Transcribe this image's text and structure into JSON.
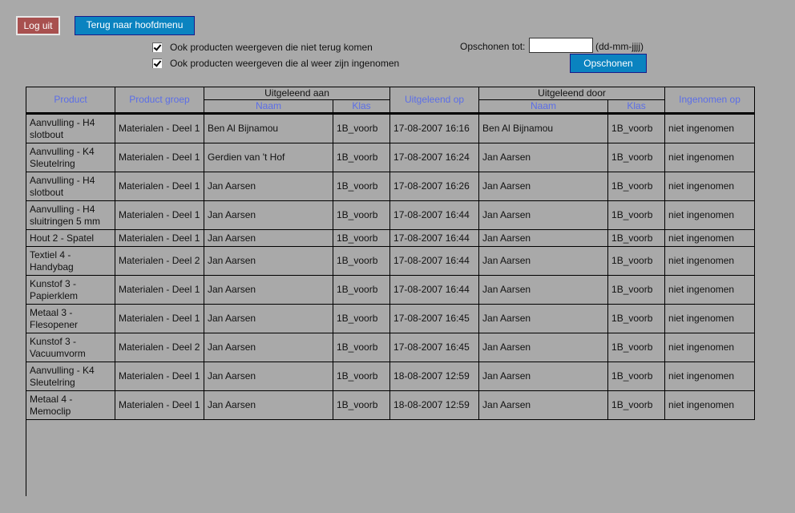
{
  "toolbar": {
    "logout_label": "Log uit",
    "back_label": "Terug naar hoofdmenu"
  },
  "filters": [
    {
      "label": "Ook producten weergeven die niet terug komen",
      "checked": true
    },
    {
      "label": "Ook producten weergeven die al weer zijn ingenomen",
      "checked": true
    }
  ],
  "cleanup": {
    "label": "Opschonen tot:",
    "value": "",
    "placeholder": "",
    "hint": "(dd-mm-jjjj)",
    "button_label": "Opschonen"
  },
  "colors": {
    "background": "#a9a9a9",
    "logout": "#a8504f",
    "primary_button": "#0a83c0",
    "header_link": "#5b6ee8"
  },
  "table": {
    "headers": {
      "product": "Product",
      "product_group": "Product groep",
      "lent_to": "Uitgeleend aan",
      "lent_on": "Uitgeleend op",
      "lent_by": "Uitgeleend door",
      "returned_on": "Ingenomen op",
      "name": "Naam",
      "class": "Klas"
    },
    "rows": [
      {
        "product": "Aanvulling - H4 slotbout",
        "group": "Materialen - Deel 1",
        "to_name": "Ben Al Bijnamou",
        "to_class": "1B_voorb",
        "date": "17-08-2007 16:16",
        "by_name": "Ben Al Bijnamou",
        "by_class": "1B_voorb",
        "returned": "niet ingenomen"
      },
      {
        "product": "Aanvulling - K4 Sleutelring",
        "group": "Materialen - Deel 1",
        "to_name": "Gerdien van 't Hof",
        "to_class": "1B_voorb",
        "date": "17-08-2007 16:24",
        "by_name": "Jan Aarsen",
        "by_class": "1B_voorb",
        "returned": "niet ingenomen"
      },
      {
        "product": "Aanvulling - H4 slotbout",
        "group": "Materialen - Deel 1",
        "to_name": "Jan Aarsen",
        "to_class": "1B_voorb",
        "date": "17-08-2007 16:26",
        "by_name": "Jan Aarsen",
        "by_class": "1B_voorb",
        "returned": "niet ingenomen"
      },
      {
        "product": "Aanvulling - H4 sluitringen 5 mm",
        "group": "Materialen - Deel 1",
        "to_name": "Jan Aarsen",
        "to_class": "1B_voorb",
        "date": "17-08-2007 16:44",
        "by_name": "Jan Aarsen",
        "by_class": "1B_voorb",
        "returned": "niet ingenomen"
      },
      {
        "product": "Hout 2 - Spatel",
        "group": "Materialen - Deel 1",
        "to_name": "Jan Aarsen",
        "to_class": "1B_voorb",
        "date": "17-08-2007 16:44",
        "by_name": "Jan Aarsen",
        "by_class": "1B_voorb",
        "returned": "niet ingenomen"
      },
      {
        "product": "Textiel 4 - Handybag",
        "group": "Materialen - Deel 2",
        "to_name": "Jan Aarsen",
        "to_class": "1B_voorb",
        "date": "17-08-2007 16:44",
        "by_name": "Jan Aarsen",
        "by_class": "1B_voorb",
        "returned": "niet ingenomen"
      },
      {
        "product": "Kunstof 3 - Papierklem",
        "group": "Materialen - Deel 1",
        "to_name": "Jan Aarsen",
        "to_class": "1B_voorb",
        "date": "17-08-2007 16:44",
        "by_name": "Jan Aarsen",
        "by_class": "1B_voorb",
        "returned": "niet ingenomen"
      },
      {
        "product": "Metaal 3 - Flesopener",
        "group": "Materialen - Deel 1",
        "to_name": "Jan Aarsen",
        "to_class": "1B_voorb",
        "date": "17-08-2007 16:45",
        "by_name": "Jan Aarsen",
        "by_class": "1B_voorb",
        "returned": "niet ingenomen"
      },
      {
        "product": "Kunstof 3 - Vacuumvorm",
        "group": "Materialen - Deel 2",
        "to_name": "Jan Aarsen",
        "to_class": "1B_voorb",
        "date": "17-08-2007 16:45",
        "by_name": "Jan Aarsen",
        "by_class": "1B_voorb",
        "returned": "niet ingenomen"
      },
      {
        "product": "Aanvulling - K4 Sleutelring",
        "group": "Materialen - Deel 1",
        "to_name": "Jan Aarsen",
        "to_class": "1B_voorb",
        "date": "18-08-2007 12:59",
        "by_name": "Jan Aarsen",
        "by_class": "1B_voorb",
        "returned": "niet ingenomen"
      },
      {
        "product": "Metaal 4 - Memoclip",
        "group": "Materialen - Deel 1",
        "to_name": "Jan Aarsen",
        "to_class": "1B_voorb",
        "date": "18-08-2007 12:59",
        "by_name": "Jan Aarsen",
        "by_class": "1B_voorb",
        "returned": "niet ingenomen"
      }
    ]
  }
}
